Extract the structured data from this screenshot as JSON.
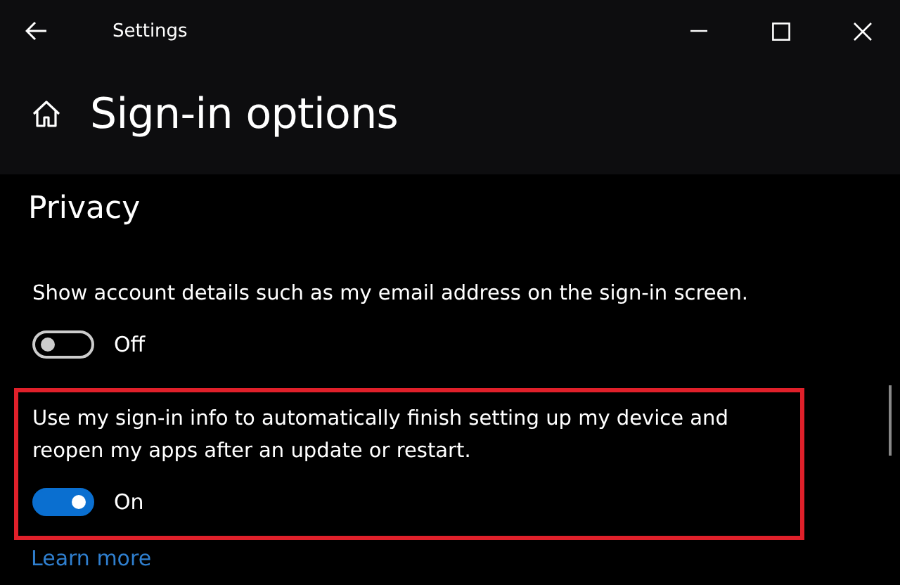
{
  "window": {
    "title": "Settings"
  },
  "page": {
    "title": "Sign-in options"
  },
  "section": {
    "title": "Privacy"
  },
  "settings": [
    {
      "description": "Show account details such as my email address on the sign-in screen.",
      "on": false,
      "state_label": "Off",
      "highlighted": false
    },
    {
      "description": "Use my sign-in info to automatically finish setting up my device and reopen my apps after an update or restart.",
      "on": true,
      "state_label": "On",
      "highlighted": true
    }
  ],
  "link": "Learn more"
}
